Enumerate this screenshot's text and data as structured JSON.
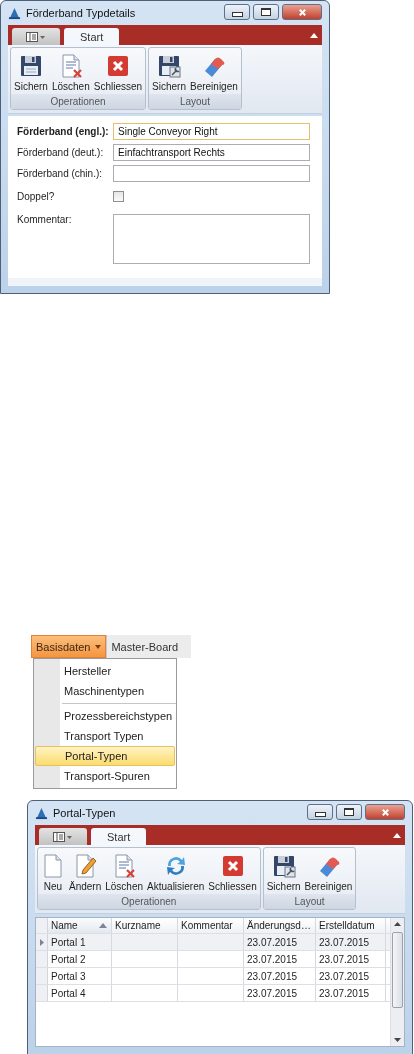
{
  "detail_window": {
    "title": "Förderband Typdetails",
    "tabs": [
      {
        "kind": "app-menu",
        "selected": false
      },
      {
        "kind": "text",
        "label": "Start",
        "selected": true
      }
    ],
    "groups": [
      {
        "label": "Operationen",
        "buttons": [
          {
            "kind": "save",
            "label": "Sichern"
          },
          {
            "kind": "delete",
            "label": "Löschen"
          },
          {
            "kind": "close",
            "label": "Schliessen"
          }
        ]
      },
      {
        "label": "Layout",
        "buttons": [
          {
            "kind": "layout-save",
            "label": "Sichern"
          },
          {
            "kind": "clear",
            "label": "Bereinigen"
          }
        ]
      }
    ],
    "form": [
      {
        "kind": "text",
        "label": "Förderband (engl.):",
        "emphasized": true,
        "focused": true,
        "value": "Single Conveyor Right"
      },
      {
        "kind": "text",
        "label": "Förderband (deut.):",
        "emphasized": false,
        "focused": false,
        "value": "Einfachtransport Rechts"
      },
      {
        "kind": "text",
        "label": "Förderband (chin.):",
        "emphasized": false,
        "focused": false
      },
      {
        "kind": "checkbox",
        "label": "Doppel?",
        "emphasized": false,
        "checked": false
      },
      {
        "kind": "textarea",
        "label": "Kommentar:",
        "emphasized": false,
        "focused": false
      }
    ]
  },
  "menu_bar": {
    "tabs": [
      {
        "label": "Basisdaten",
        "selected": true
      },
      {
        "label": "Master-Board",
        "selected": false
      }
    ]
  },
  "dropdown": {
    "items": [
      {
        "kind": "item",
        "label": "Hersteller",
        "selected": false
      },
      {
        "kind": "item",
        "label": "Maschinentypen",
        "selected": false
      },
      {
        "kind": "separator"
      },
      {
        "kind": "item",
        "label": "Prozessbereichstypen",
        "selected": false
      },
      {
        "kind": "item",
        "label": "Transport Typen",
        "selected": false
      },
      {
        "kind": "item",
        "label": "Portal-Typen",
        "selected": true
      },
      {
        "kind": "item",
        "label": "Transport-Spuren",
        "selected": false
      }
    ]
  },
  "list_window": {
    "title": "Portal-Typen",
    "tabs": [
      {
        "kind": "app-menu",
        "selected": false
      },
      {
        "kind": "text",
        "label": "Start",
        "selected": true
      }
    ],
    "groups": [
      {
        "label": "Operationen",
        "buttons": [
          {
            "kind": "new",
            "label": "Neu"
          },
          {
            "kind": "edit",
            "label": "Ändern"
          },
          {
            "kind": "delete",
            "label": "Löschen"
          },
          {
            "kind": "refresh",
            "label": "Aktualisieren"
          },
          {
            "kind": "close",
            "label": "Schliessen"
          }
        ]
      },
      {
        "label": "Layout",
        "buttons": [
          {
            "kind": "layout-save",
            "label": "Sichern"
          },
          {
            "kind": "clear",
            "label": "Bereinigen"
          }
        ]
      }
    ],
    "grid": {
      "columns": [
        {
          "label": "Name",
          "sorted": true
        },
        {
          "label": "Kurzname",
          "sorted": false
        },
        {
          "label": "Kommentar",
          "sorted": false
        },
        {
          "label": "Änderungsd…",
          "sorted": false
        },
        {
          "label": "Erstelldatum",
          "sorted": false
        }
      ],
      "rows": [
        {
          "selected": true,
          "cells": [
            "Portal 1",
            null,
            null,
            "23.07.2015",
            "23.07.2015"
          ]
        },
        {
          "selected": false,
          "cells": [
            "Portal 2",
            null,
            null,
            "23.07.2015",
            "23.07.2015"
          ]
        },
        {
          "selected": false,
          "cells": [
            "Portal 3",
            null,
            null,
            "23.07.2015",
            "23.07.2015"
          ]
        },
        {
          "selected": false,
          "cells": [
            "Portal 4",
            null,
            null,
            "23.07.2015",
            "23.07.2015"
          ]
        }
      ]
    }
  }
}
